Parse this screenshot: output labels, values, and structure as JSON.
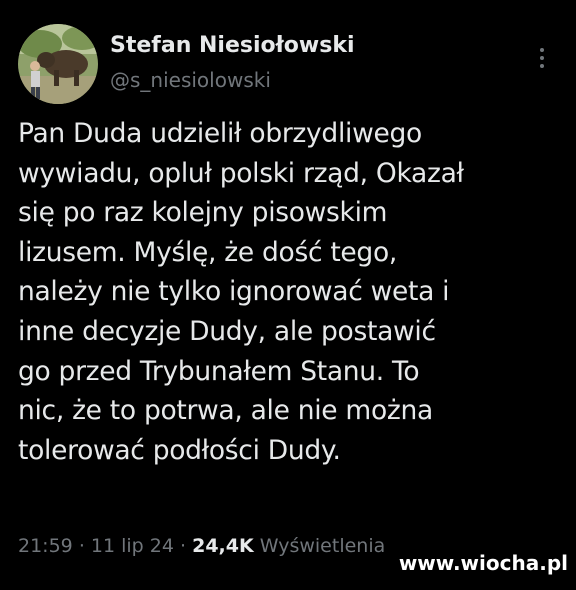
{
  "author": {
    "display_name": "Stefan Niesiołowski",
    "handle": "@s_niesiolowski"
  },
  "tweet": {
    "lines": [
      "Pan Duda udzielił obrzydliwego",
      "wywiadu, opluł polski rząd, Okazał",
      "się po raz kolejny pisowskim",
      "lizusem. Myślę, że dość tego,",
      "należy nie tylko ignorować weta i",
      "inne decyzje Dudy, ale postawić",
      "go przed Trybunałem Stanu. To",
      "nic, że to potrwa, ale nie można",
      "tolerować podłości Dudy."
    ]
  },
  "meta": {
    "time": "21:59",
    "separator": "·",
    "date": "11 lip 24",
    "views_count": "24,4K",
    "views_label": "Wyświetlenia"
  },
  "watermark": "www.wiocha.pl",
  "icons": {
    "more": "more-options-icon"
  },
  "colors": {
    "background": "#000000",
    "primary_text": "#e7e9ea",
    "secondary_text": "#71767b"
  }
}
